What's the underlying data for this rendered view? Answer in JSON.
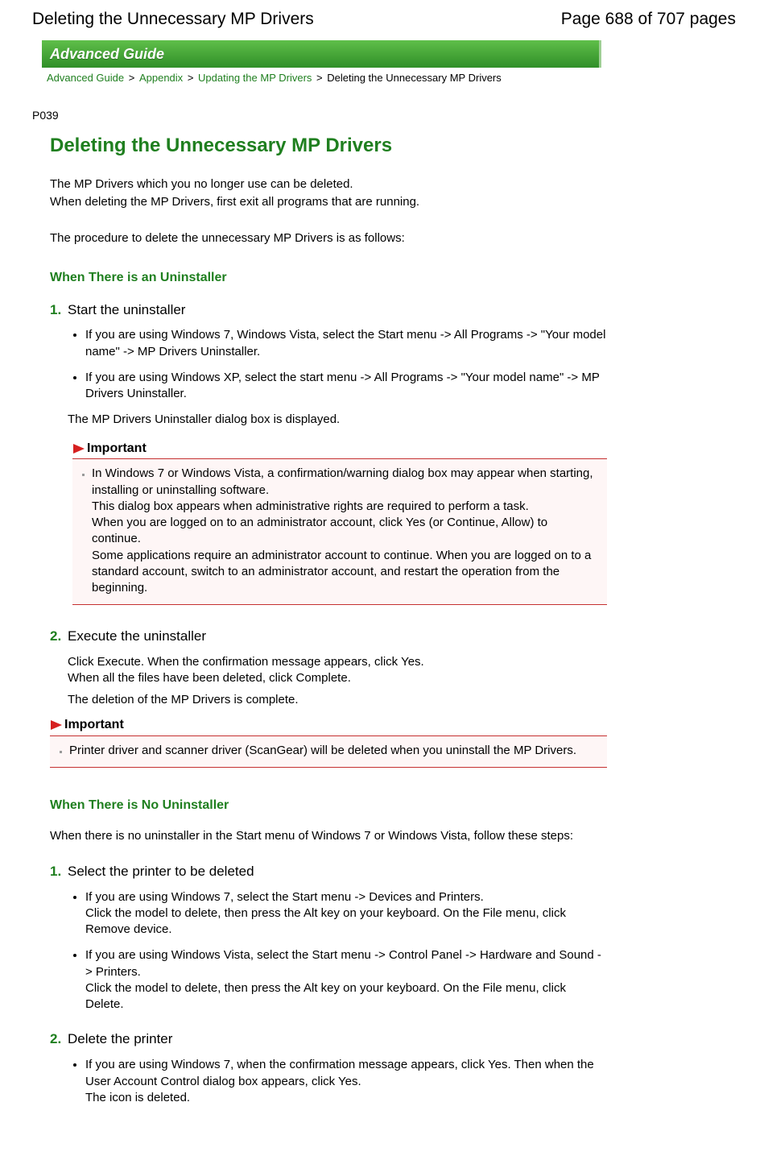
{
  "top": {
    "title": "Deleting the Unnecessary MP Drivers",
    "page_indicator": "Page 688 of 707 pages"
  },
  "banner": {
    "label": "Advanced Guide"
  },
  "breadcrumb": {
    "link1": "Advanced Guide",
    "link2": "Appendix",
    "link3": "Updating the MP Drivers",
    "current": "Deleting the Unnecessary MP Drivers"
  },
  "code_id": "P039",
  "page_heading": "Deleting the Unnecessary MP Drivers",
  "intro": {
    "line1": "The MP Drivers which you no longer use can be deleted.",
    "line2": "When deleting the MP Drivers, first exit all programs that are running."
  },
  "procedure_intro": "The procedure to delete the unnecessary MP Drivers is as follows:",
  "section1": {
    "heading": "When There is an Uninstaller",
    "step1": {
      "num": "1.",
      "title": "Start the uninstaller",
      "bullet1": "If you are using Windows 7, Windows Vista, select the Start menu -> All Programs -> \"Your model name\" -> MP Drivers Uninstaller.",
      "bullet2": "If you are using Windows XP, select the start menu -> All Programs -> \"Your model name\" -> MP Drivers Uninstaller.",
      "after": "The MP Drivers Uninstaller dialog box is displayed.",
      "important_label": "Important",
      "important_body": "In Windows 7 or Windows Vista, a confirmation/warning dialog box may appear when starting, installing or uninstalling software.\nThis dialog box appears when administrative rights are required to perform a task.\nWhen you are logged on to an administrator account, click Yes (or Continue, Allow) to continue.\nSome applications require an administrator account to continue. When you are logged on to a standard account, switch to an administrator account, and restart the operation from the beginning."
    },
    "step2": {
      "num": "2.",
      "title": "Execute the uninstaller",
      "line1": "Click Execute. When the confirmation message appears, click Yes.",
      "line2": "When all the files have been deleted, click Complete.",
      "line3": "The deletion of the MP Drivers is complete."
    },
    "important2": {
      "label": "Important",
      "body": "Printer driver and scanner driver (ScanGear) will be deleted when you uninstall the MP Drivers."
    }
  },
  "section2": {
    "heading": "When There is No Uninstaller",
    "intro": "When there is no uninstaller in the Start menu of Windows 7 or Windows Vista, follow these steps:",
    "step1": {
      "num": "1.",
      "title": "Select the printer to be deleted",
      "bullet1a": "If you are using Windows 7, select the Start menu -> Devices and Printers.",
      "bullet1b": "Click the model to delete, then press the Alt key on your keyboard. On the File menu, click Remove device.",
      "bullet2a": "If you are using Windows Vista, select the Start menu -> Control Panel -> Hardware and Sound -> Printers.",
      "bullet2b": "Click the model to delete, then press the Alt key on your keyboard. On the File menu, click Delete."
    },
    "step2": {
      "num": "2.",
      "title": "Delete the printer",
      "bullet1a": "If you are using Windows 7, when the confirmation message appears, click Yes. Then when the User Account Control dialog box appears, click Yes.",
      "bullet1b": "The icon is deleted."
    }
  }
}
